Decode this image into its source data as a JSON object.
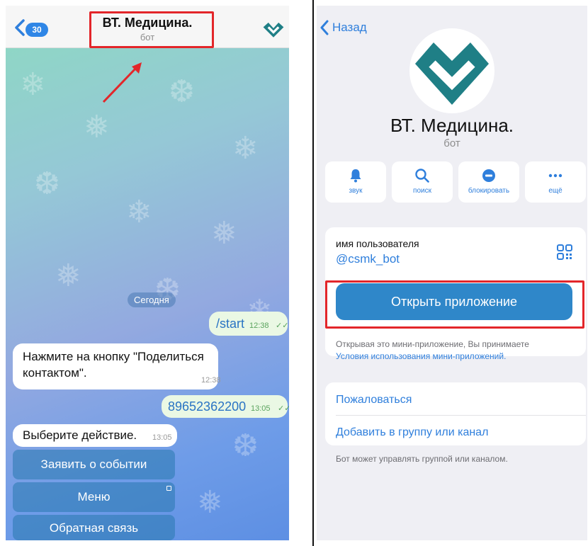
{
  "chat": {
    "unread_count": "30",
    "title": "ВТ. Медицина.",
    "subtitle": "бот",
    "date_divider": "Сегодня",
    "messages": [
      {
        "text": "/start",
        "time": "12:38",
        "status": "✓✓"
      },
      {
        "text": "Нажмите на кнопку \"Поделиться контактом\".",
        "time": "12:38"
      },
      {
        "text": "89652362200",
        "time": "13:05",
        "status": "✓✓"
      },
      {
        "text": "Выберите действие.",
        "time": "13:05"
      }
    ],
    "keyboard": [
      {
        "label": "Заявить о событии"
      },
      {
        "label": "Меню"
      },
      {
        "label": "Обратная связь"
      }
    ]
  },
  "profile": {
    "back_label": "Назад",
    "name": "ВТ. Медицина.",
    "subtitle": "бот",
    "actions": [
      {
        "label": "звук",
        "icon": "bell-icon"
      },
      {
        "label": "поиск",
        "icon": "search-icon"
      },
      {
        "label": "блокировать",
        "icon": "block-icon"
      },
      {
        "label": "ещё",
        "icon": "more-icon"
      }
    ],
    "username_label": "имя пользователя",
    "username": "@csmk_bot",
    "open_app_label": "Открыть приложение",
    "terms_text": "Открывая это мини-приложение, Вы принимаете",
    "terms_link": "Условия использования мини-приложений.",
    "report_label": "Пожаловаться",
    "add_group_label": "Добавить в группу или канал",
    "bot_note": "Бот может управлять группой или каналом."
  },
  "colors": {
    "accent_blue": "#2f7fdc",
    "highlight_red": "#e3262a",
    "logo_teal": "#1f7f86",
    "open_button": "#2f87c9"
  }
}
